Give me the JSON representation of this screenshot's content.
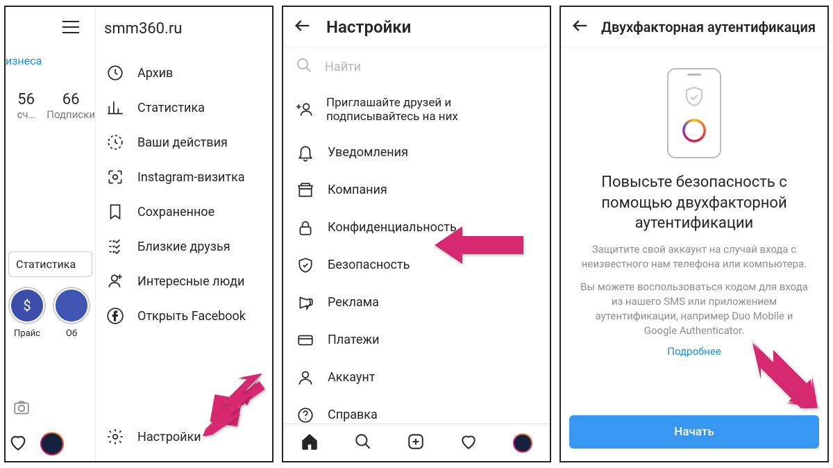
{
  "panel1": {
    "username": "smm360.ru",
    "business_link": "изнеса",
    "stat_a_num": "56",
    "stat_a_lbl": "сч…",
    "stat_b_num": "66",
    "stat_b_lbl": "Подписки",
    "stats_button": "Статистика",
    "story1_label": "Прайс",
    "story2_label": "Об",
    "menu": {
      "archive": "Архив",
      "stats": "Статистика",
      "activity": "Ваши действия",
      "nametag": "Instagram-визитка",
      "saved": "Сохраненное",
      "close_friends": "Близкие друзья",
      "discover": "Интересные люди",
      "facebook": "Открыть Facebook",
      "settings": "Настройки"
    }
  },
  "panel2": {
    "title": "Настройки",
    "search_placeholder": "Найти",
    "items": {
      "invite": "Приглашайте друзей и подписывайтесь на них",
      "notifications": "Уведомления",
      "business": "Компания",
      "privacy": "Конфиденциальность",
      "security": "Безопасность",
      "ads": "Реклама",
      "payments": "Платежи",
      "account": "Аккаунт",
      "help": "Справка"
    }
  },
  "panel3": {
    "title": "Двухфакторная аутентификация",
    "big_title": "Повысьте безопасность с помощью двухфакторной аутентификации",
    "para1": "Защитите свой аккаунт на случай входа с неизвестного нам телефона или компьютера.",
    "para2": "Вы можете воспользоваться кодом для входа из нашего SMS или приложением аутентификации, например Duo Mobile и Google Authenticator.",
    "learn_more": "Подробнее",
    "start": "Начать"
  }
}
